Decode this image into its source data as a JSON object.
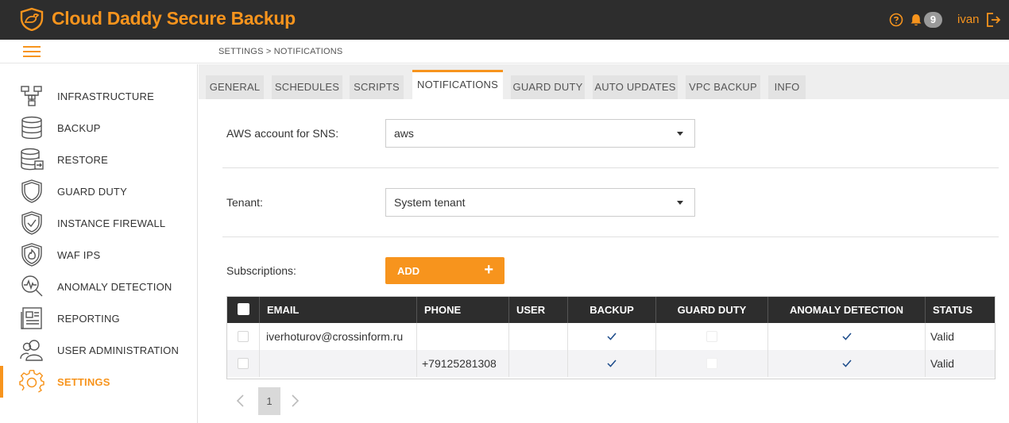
{
  "app": {
    "title": "Cloud Daddy Secure Backup",
    "notification_count": "9",
    "user": "ivan"
  },
  "breadcrumb": "SETTINGS > NOTIFICATIONS",
  "colors": {
    "accent": "#f7941d",
    "header_bg": "#2d2d2d"
  },
  "sidebar": {
    "items": [
      {
        "label": "INFRASTRUCTURE",
        "icon": "network-icon"
      },
      {
        "label": "BACKUP",
        "icon": "database-icon"
      },
      {
        "label": "RESTORE",
        "icon": "database-restore-icon"
      },
      {
        "label": "GUARD DUTY",
        "icon": "shield-icon"
      },
      {
        "label": "INSTANCE FIREWALL",
        "icon": "shield-check-icon"
      },
      {
        "label": "WAF IPS",
        "icon": "shield-fire-icon"
      },
      {
        "label": "ANOMALY DETECTION",
        "icon": "magnifier-pulse-icon"
      },
      {
        "label": "REPORTING",
        "icon": "newspaper-icon"
      },
      {
        "label": "USER ADMINISTRATION",
        "icon": "users-icon"
      },
      {
        "label": "SETTINGS",
        "icon": "gear-icon",
        "active": true
      }
    ]
  },
  "tabs": [
    {
      "label": "GENERAL"
    },
    {
      "label": "SCHEDULES"
    },
    {
      "label": "SCRIPTS"
    },
    {
      "label": "NOTIFICATIONS",
      "active": true
    },
    {
      "label": "GUARD DUTY"
    },
    {
      "label": "AUTO UPDATES"
    },
    {
      "label": "VPC BACKUP"
    },
    {
      "label": "INFO"
    }
  ],
  "form": {
    "aws_account_label": "AWS account for SNS:",
    "aws_account_value": "aws",
    "tenant_label": "Tenant:",
    "tenant_value": "System tenant",
    "subscriptions_label": "Subscriptions:",
    "add_label": "ADD",
    "add_icon": "+"
  },
  "table": {
    "columns": [
      "EMAIL",
      "PHONE",
      "USER",
      "BACKUP",
      "GUARD DUTY",
      "ANOMALY DETECTION",
      "STATUS"
    ],
    "rows": [
      {
        "email": "iverhoturov@crossinform.ru",
        "phone": "",
        "user": "",
        "backup": true,
        "guard_duty": false,
        "anomaly_detection": true,
        "status": "Valid"
      },
      {
        "email": "",
        "phone": "+79125281308",
        "user": "",
        "backup": true,
        "guard_duty": false,
        "anomaly_detection": true,
        "status": "Valid"
      }
    ]
  },
  "pagination": {
    "current_page": "1"
  }
}
